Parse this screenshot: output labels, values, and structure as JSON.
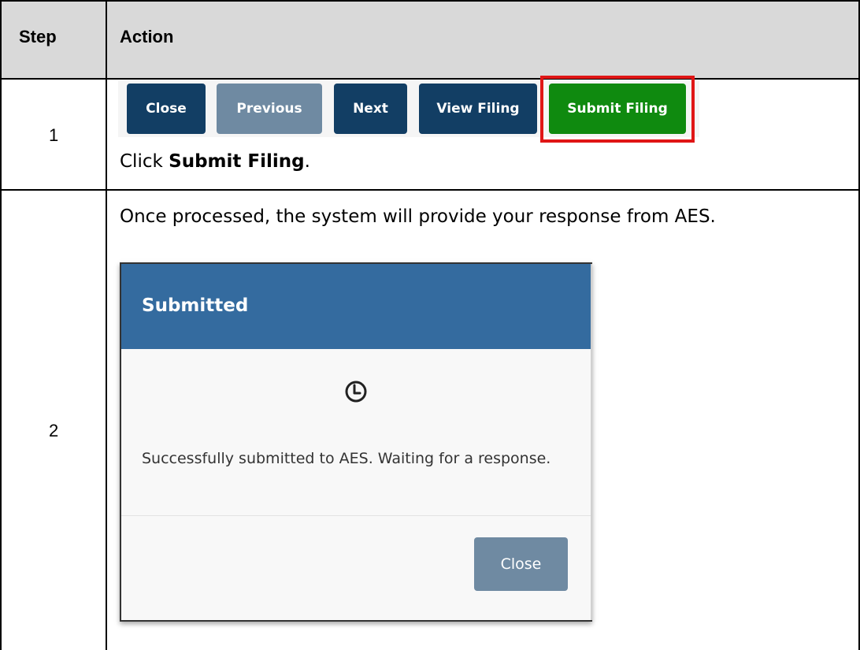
{
  "table": {
    "headers": [
      "Step",
      "Action"
    ],
    "rows": [
      {
        "step": "1",
        "instruction": {
          "prefix": "Click ",
          "emphasis": "Submit Filing",
          "suffix": "."
        }
      },
      {
        "step": "2",
        "instruction": {
          "text": "Once processed, the system will provide your response from AES."
        }
      }
    ]
  },
  "toolbar": {
    "buttons": [
      {
        "label": "Close",
        "state": "active"
      },
      {
        "label": "Previous",
        "state": "disabled"
      },
      {
        "label": "Next",
        "state": "active"
      },
      {
        "label": "View Filing",
        "state": "active"
      },
      {
        "label": "Submit Filing",
        "state": "primary",
        "highlighted": true
      }
    ]
  },
  "modal": {
    "title": "Submitted",
    "icon": "clock-icon",
    "message": "Successfully submitted to AES. Waiting for a response.",
    "close_label": "Close"
  },
  "colors": {
    "header_bg": "#d9d9d9",
    "button_dark": "#123e64",
    "button_muted": "#6f8aa2",
    "button_green": "#0f8a0f",
    "highlight_red": "#e01616",
    "modal_header": "#346b9f"
  }
}
